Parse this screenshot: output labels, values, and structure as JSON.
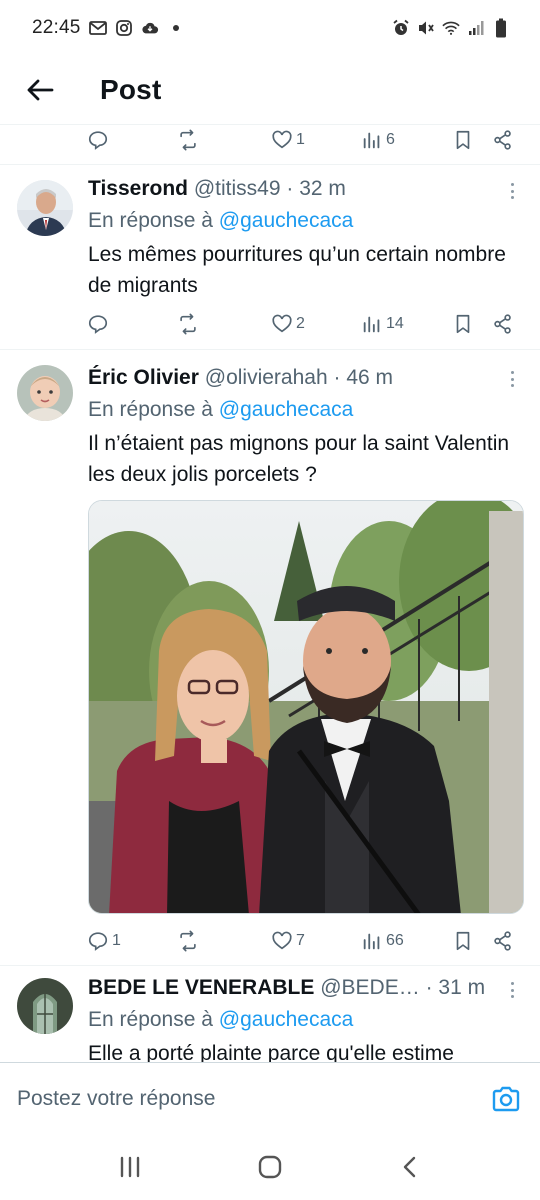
{
  "status_bar": {
    "time": "22:45",
    "left_icons": [
      "gmail-icon",
      "instagram-icon",
      "cloud-icon",
      "dot-icon"
    ],
    "right_icons": [
      "alarm-icon",
      "mute-icon",
      "wifi-icon",
      "signal-icon",
      "battery-icon"
    ]
  },
  "header": {
    "title": "Post"
  },
  "top_action_bar": {
    "reply_count": "",
    "retweet_count": "",
    "like_count": "1",
    "view_count": "6"
  },
  "posts": [
    {
      "author": "Tisserond",
      "handle": "@titiss49",
      "separator": " · ",
      "time": "32 m",
      "reply_prefix": "En réponse à ",
      "reply_to": "@gauchecaca",
      "text": "Les mêmes pourritures qu’un certain nombre de migrants",
      "reply_count": "",
      "retweet_count": "",
      "like_count": "2",
      "view_count": "14"
    },
    {
      "author": "Éric Olivier",
      "handle": "@olivierahah",
      "separator": " · ",
      "time": "46 m",
      "reply_prefix": "En réponse à ",
      "reply_to": "@gauchecaca",
      "text": "Il n’étaient pas mignons pour la saint Valentin les deux jolis porcelets ?",
      "reply_count": "1",
      "retweet_count": "",
      "like_count": "7",
      "view_count": "66"
    },
    {
      "author": "BEDE LE VENERABLE",
      "handle": "@BEDE…",
      "separator": " · ",
      "time": "31 m",
      "reply_prefix": "En réponse à ",
      "reply_to": "@gauchecaca",
      "text": "Elle a porté plainte parce qu'elle estime"
    }
  ],
  "reply_composer": {
    "placeholder": "Postez votre réponse"
  },
  "nav_bar": {
    "buttons": [
      "recents-icon",
      "home-icon",
      "back-icon"
    ]
  },
  "colors": {
    "accent": "#1d9bf0",
    "text": "#0f1419",
    "muted": "#536471",
    "divider": "#eff3f4"
  }
}
